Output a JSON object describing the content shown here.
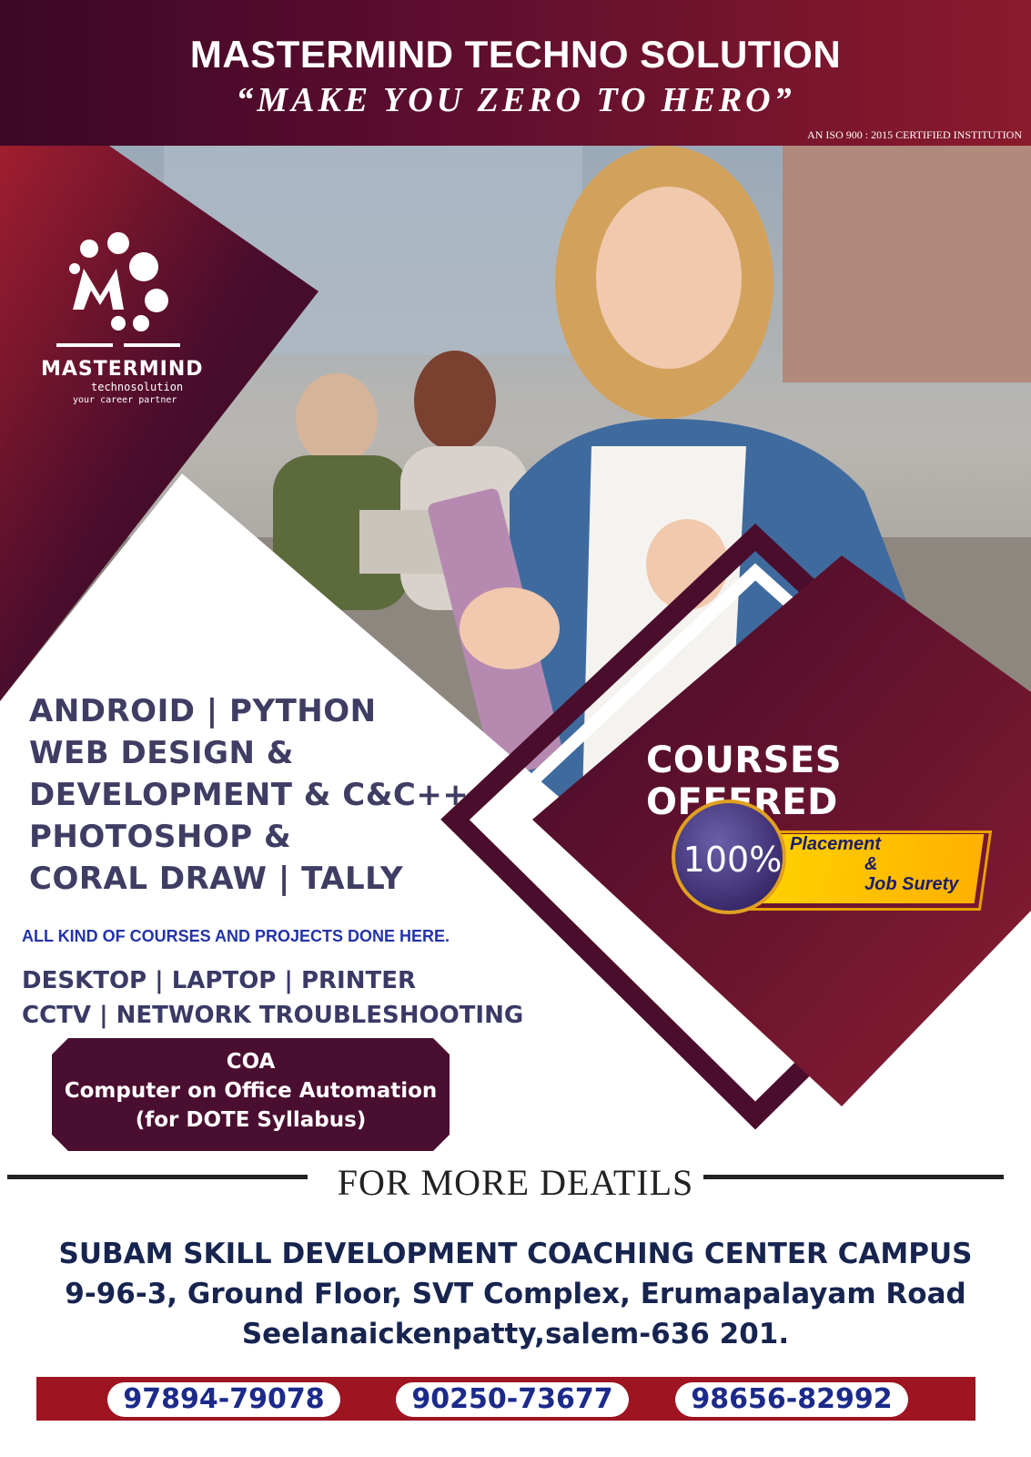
{
  "header": {
    "title": "MASTERMIND TECHNO SOLUTION",
    "tagline": "“MAKE  YOU  ZERO  TO  HERO”",
    "iso": "AN ISO 900 : 2015 CERTIFIED INSTITUTION"
  },
  "logo": {
    "wordmark": "MASTERMIND",
    "sub": "technosolution",
    "sub2": "your career partner"
  },
  "courses": [
    "ANDROID | PYTHON",
    "WEB DESIGN &",
    "DEVELOPMENT & C&C++",
    "PHOTOSHOP &",
    "CORAL DRAW | TALLY"
  ],
  "courses_offered": "COURSES OFFERED",
  "badge": {
    "percent": "100%",
    "line1": "Placement",
    "line2": "&",
    "line3": "Job Surety"
  },
  "all_kind": "ALL KIND OF COURSES AND PROJECTS DONE HERE.",
  "hardware": [
    "DESKTOP | LAPTOP | PRINTER",
    "CCTV | NETWORK TROUBLESHOOTING"
  ],
  "coa": [
    "COA",
    "Computer on Office Automation",
    "(for DOTE Syllabus)"
  ],
  "more_details": "FOR MORE DEATILS",
  "address": [
    "SUBAM SKILL DEVELOPMENT COACHING CENTER CAMPUS",
    "9-96-3, Ground Floor, SVT Complex, Erumapalayam Road",
    "Seelanaickenpatty,salem-636 201."
  ],
  "phones": [
    "97894-79078",
    "90250-73677",
    "98656-82992"
  ],
  "colors": {
    "maroon_dark": "#3d0726",
    "maroon": "#7a1833",
    "red_accent": "#9e1420",
    "navy_text": "#16244f",
    "badge_yellow": "#ffd400"
  }
}
